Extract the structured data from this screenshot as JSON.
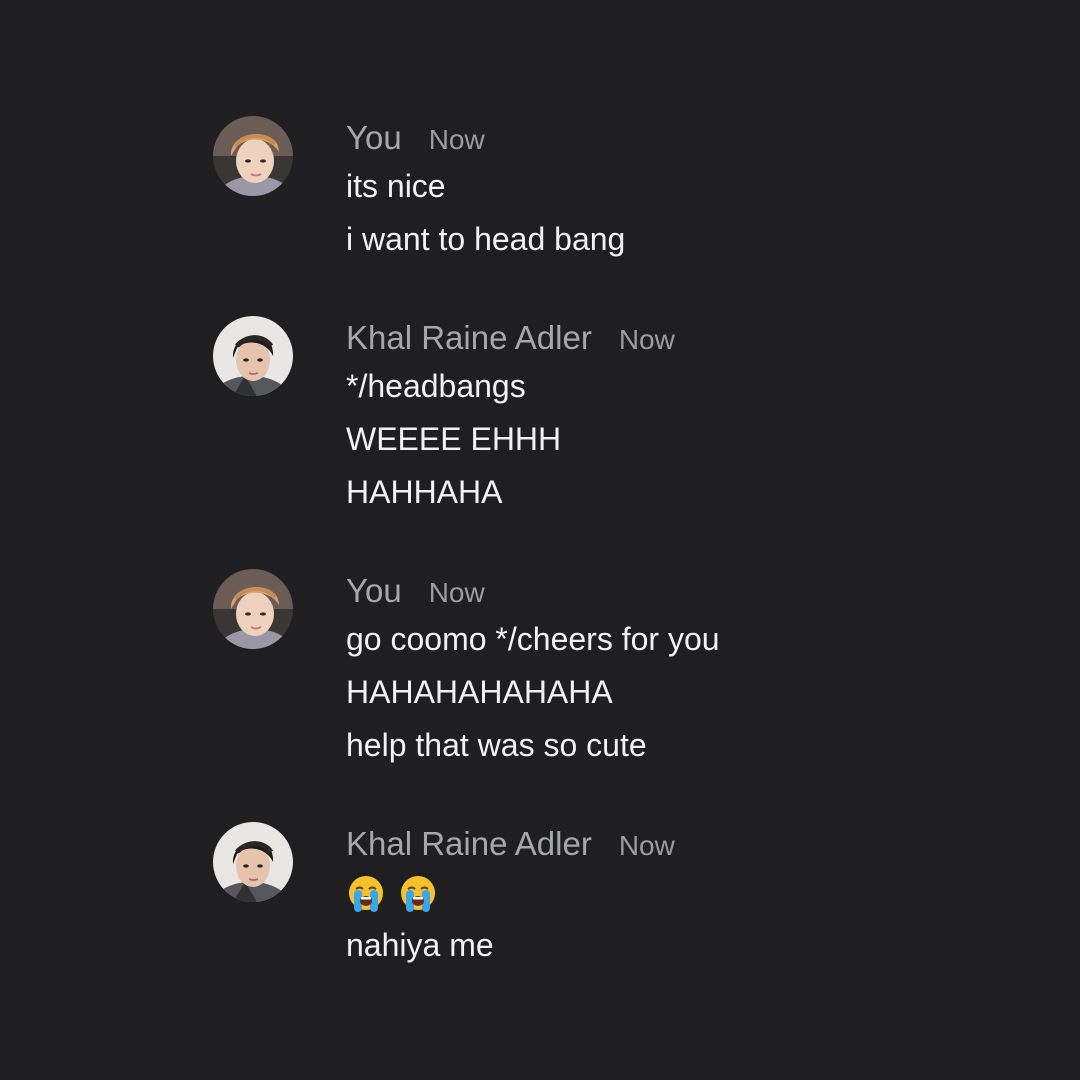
{
  "messages": [
    {
      "author": "You",
      "time": "Now",
      "avatar": "self-avatar",
      "lines": [
        "its nice",
        "i want to head bang"
      ]
    },
    {
      "author": "Khal Raine Adler",
      "time": "Now",
      "avatar": "contact-avatar",
      "lines": [
        "*/headbangs",
        "WEEEE EHHH",
        "HAHHAHA"
      ]
    },
    {
      "author": "You",
      "time": "Now",
      "avatar": "self-avatar",
      "lines": [
        "go coomo */cheers for you",
        "HAHAHAHAHAHA",
        "help that was so cute"
      ]
    },
    {
      "author": "Khal Raine Adler",
      "time": "Now",
      "avatar": "contact-avatar",
      "emoji": [
        "loudly-crying-face-icon",
        "loudly-crying-face-icon"
      ],
      "lines": [
        "nahiya me"
      ]
    }
  ],
  "colors": {
    "background": "#1f1f21",
    "author": "#a6a7ab",
    "timestamp": "#9c9da1",
    "message_text": "#f2f2f4"
  }
}
